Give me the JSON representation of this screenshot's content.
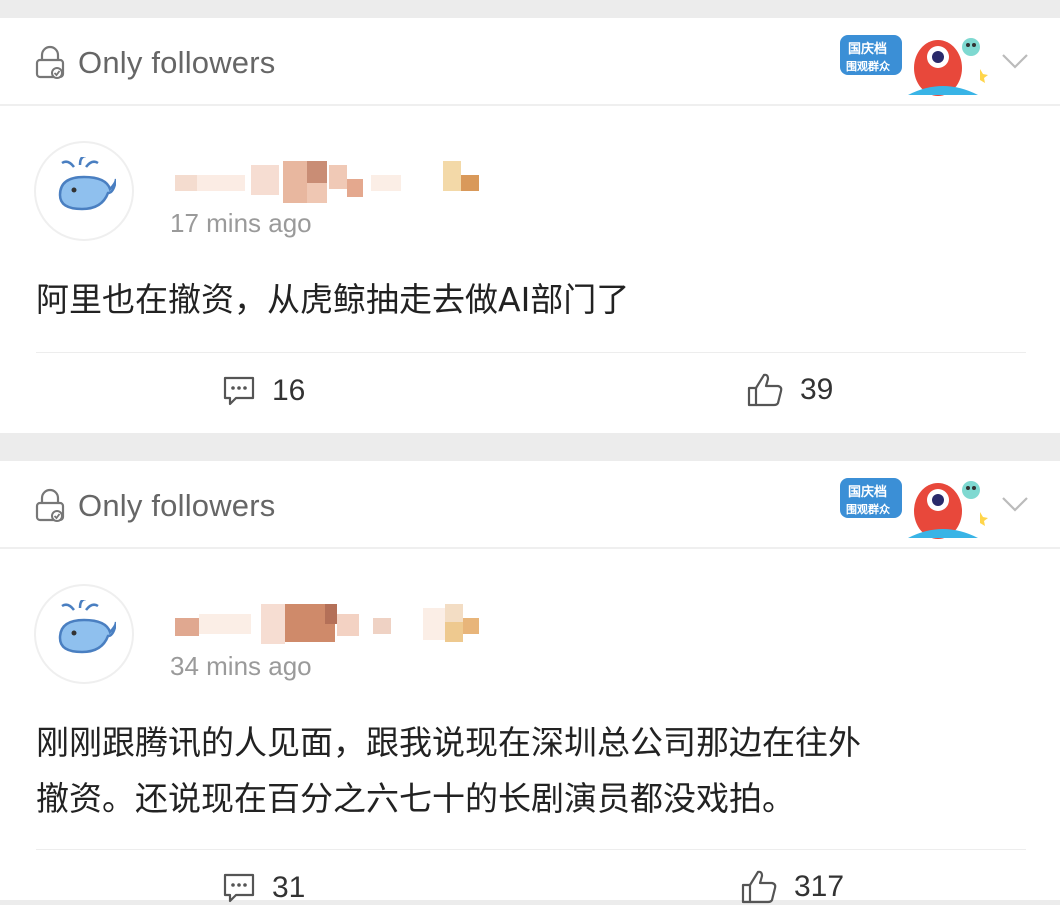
{
  "colors": {
    "page_bg": "#ececec",
    "card_bg": "#ffffff",
    "secondary_text": "#9a9a9a",
    "avatar_whale": "#4a7fc1"
  },
  "posts": [
    {
      "visibility": "Only followers",
      "time": "17 mins ago",
      "text_lines": [
        "阿里也在撤资，从虎鲸抽走去做AI部门了"
      ],
      "comments": "16",
      "likes": "39"
    },
    {
      "visibility": "Only followers",
      "time": "34 mins ago",
      "text_lines": [
        "刚刚跟腾讯的人见面，跟我说现在深圳总公司那边在往外",
        "撤资。还说现在百分之六七十的长剧演员都没戏拍。"
      ],
      "comments": "31",
      "likes": "317"
    }
  ],
  "sticker": {
    "text_line1": "国庆档",
    "text_line2": "围观群众"
  },
  "icons": {
    "lock": "lock-icon",
    "chevron": "chevron-down-icon",
    "comment": "comment-icon",
    "like": "thumbs-up-icon",
    "avatar": "whale-avatar-icon"
  }
}
